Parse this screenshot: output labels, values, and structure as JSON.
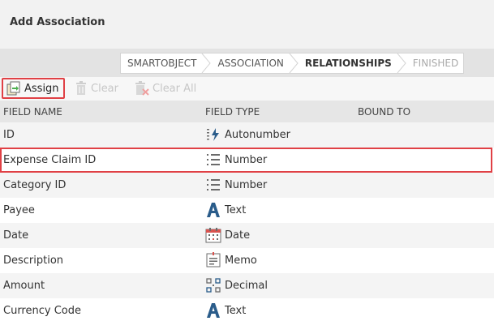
{
  "dialog": {
    "title": "Add Association"
  },
  "wizard": {
    "steps": [
      {
        "label": "SMARTOBJECT",
        "state": "done"
      },
      {
        "label": "ASSOCIATION",
        "state": "done"
      },
      {
        "label": "RELATIONSHIPS",
        "state": "active"
      },
      {
        "label": "FINISHED",
        "state": "disabled"
      }
    ]
  },
  "toolbar": {
    "assign_label": "Assign",
    "clear_label": "Clear",
    "clear_all_label": "Clear All"
  },
  "table": {
    "columns": [
      "FIELD NAME",
      "FIELD TYPE",
      "BOUND TO"
    ],
    "rows": [
      {
        "name": "ID",
        "type": "Autonumber",
        "icon": "autonumber-icon"
      },
      {
        "name": "Expense Claim ID",
        "type": "Number",
        "icon": "number-icon"
      },
      {
        "name": "Category ID",
        "type": "Number",
        "icon": "number-icon"
      },
      {
        "name": "Payee",
        "type": "Text",
        "icon": "text-icon"
      },
      {
        "name": "Date",
        "type": "Date",
        "icon": "calendar-icon"
      },
      {
        "name": "Description",
        "type": "Memo",
        "icon": "memo-icon"
      },
      {
        "name": "Amount",
        "type": "Decimal",
        "icon": "decimal-icon"
      },
      {
        "name": "Currency Code",
        "type": "Text",
        "icon": "text-icon"
      }
    ]
  },
  "colors": {
    "highlight": "#e04045",
    "text_icon": "#2a5c8a",
    "disabled": "#c7c7c7"
  }
}
